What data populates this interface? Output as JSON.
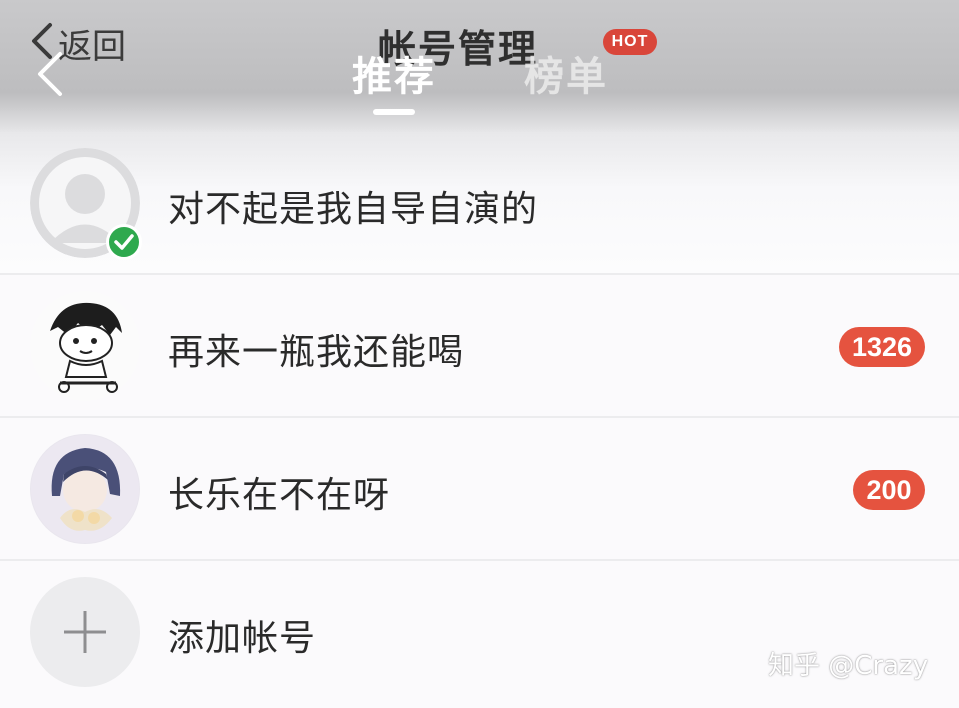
{
  "header": {
    "back_label": "返回",
    "title": "帐号管理",
    "tabs": [
      {
        "label": "推荐",
        "active": true
      },
      {
        "label": "榜单",
        "active": false
      }
    ],
    "hot_badge": "HOT"
  },
  "accounts": [
    {
      "name": "对不起是我自导自演的",
      "badge": null,
      "current": true,
      "avatar": "default-avatar"
    },
    {
      "name": "再来一瓶我还能喝",
      "badge": "1326",
      "current": false,
      "avatar": "cartoon-avatar"
    },
    {
      "name": "长乐在不在呀",
      "badge": "200",
      "current": false,
      "avatar": "anime-avatar"
    }
  ],
  "add_account": {
    "label": "添加帐号"
  },
  "watermark": "知乎 @Crazy",
  "colors": {
    "badge_red": "#e5533f",
    "check_green": "#2fa94e",
    "hot_red": "#d9463a"
  }
}
